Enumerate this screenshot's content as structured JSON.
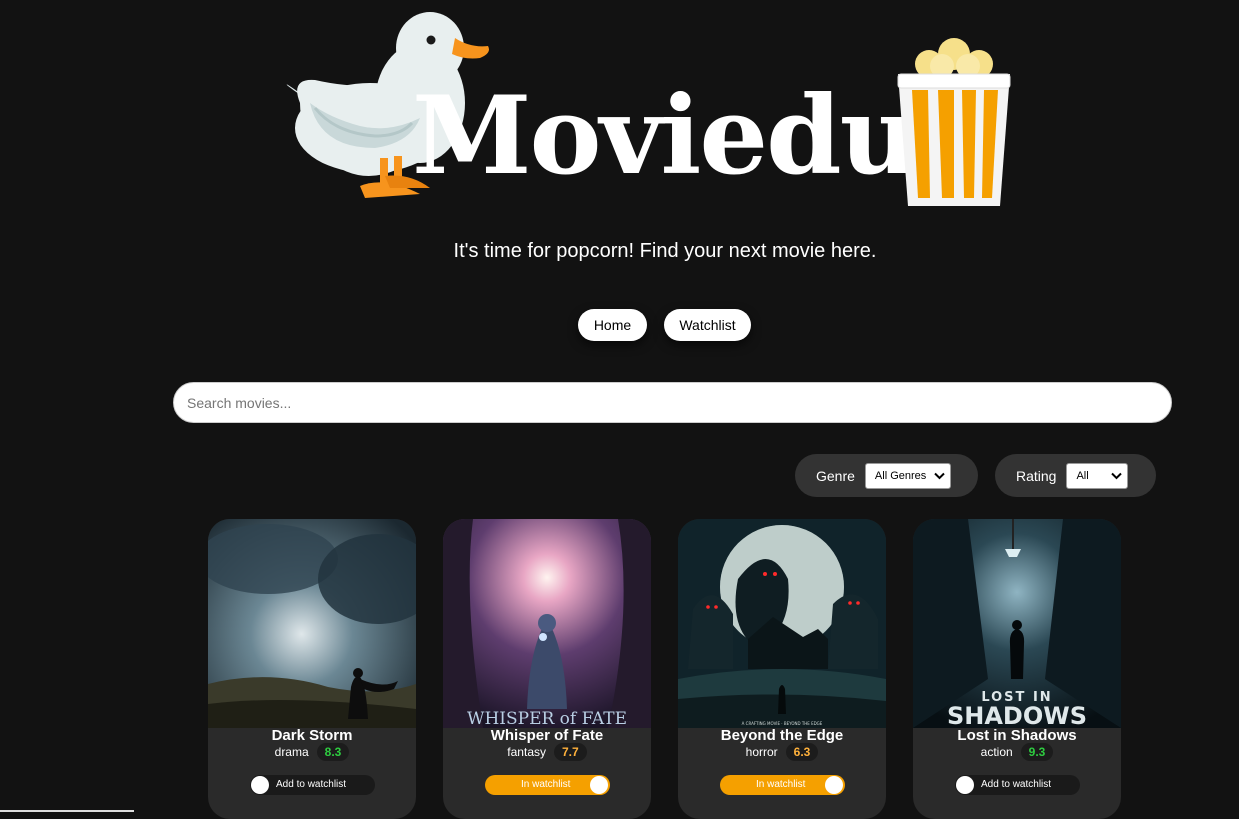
{
  "brand": {
    "name": "Moviedux",
    "logo_left_icon": "duck-icon",
    "logo_right_icon": "popcorn-icon"
  },
  "tagline": "It's time for popcorn! Find your next movie here.",
  "nav": {
    "home_label": "Home",
    "watchlist_label": "Watchlist"
  },
  "search": {
    "placeholder": "Search movies...",
    "value": ""
  },
  "filters": {
    "genre": {
      "label": "Genre",
      "selected": "All Genres"
    },
    "rating": {
      "label": "Rating",
      "selected": "All"
    }
  },
  "movies": [
    {
      "title": "Dark Storm",
      "genre": "drama",
      "rating": "8.3",
      "rating_color": "#2ecc40",
      "watchlist_label": "Add to watchlist",
      "in_watchlist": false
    },
    {
      "title": "Whisper of Fate",
      "genre": "fantasy",
      "rating": "7.7",
      "rating_color": "#ffb13b",
      "watchlist_label": "In watchlist",
      "in_watchlist": true,
      "poster_text": "WHISPER of FATE"
    },
    {
      "title": "Beyond the Edge",
      "genre": "horror",
      "rating": "6.3",
      "rating_color": "#ffb13b",
      "watchlist_label": "In watchlist",
      "in_watchlist": true,
      "poster_text": "A CRAFTING MOVIE · BEYOND THE EDGE"
    },
    {
      "title": "Lost in Shadows",
      "genre": "action",
      "rating": "9.3",
      "rating_color": "#2ecc40",
      "watchlist_label": "Add to watchlist",
      "in_watchlist": false,
      "poster_text": "LOST IN SHADOWS"
    }
  ],
  "colors": {
    "background": "#121212",
    "card": "#2a2a2a",
    "accent": "#f5a000",
    "rating_good": "#2ecc40",
    "rating_ok": "#ffb13b"
  }
}
